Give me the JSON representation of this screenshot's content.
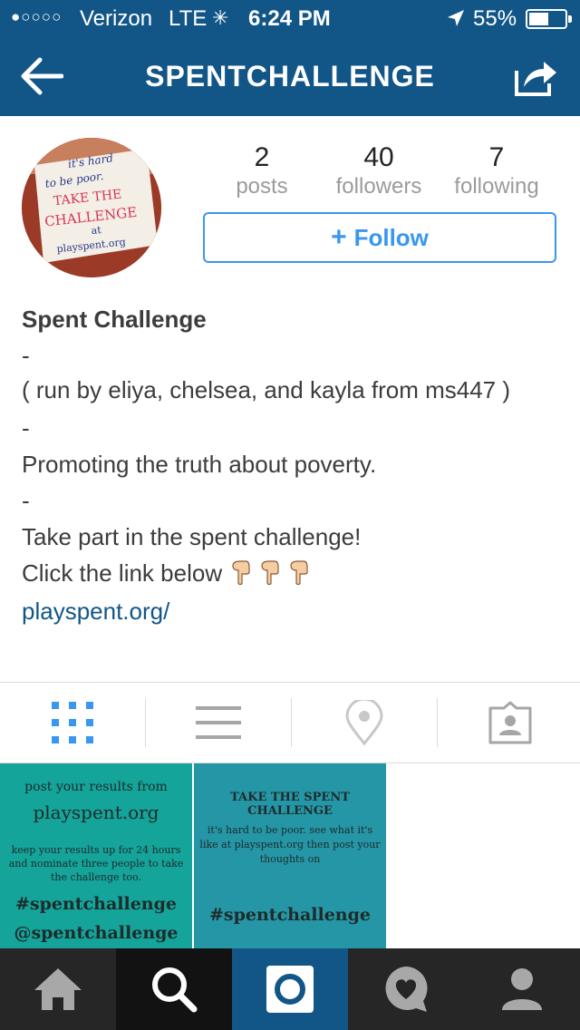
{
  "status_bar": {
    "signal_dots": "●○○○○",
    "carrier": "Verizon",
    "network": "LTE",
    "time": "6:24 PM",
    "battery_percent": "55%",
    "battery_level": 0.55
  },
  "header": {
    "title": "SPENTCHALLENGE"
  },
  "profile": {
    "stats": [
      {
        "value": "2",
        "label": "posts"
      },
      {
        "value": "40",
        "label": "followers"
      },
      {
        "value": "7",
        "label": "following"
      }
    ],
    "follow_label": "Follow",
    "avatar_text": {
      "line1": "it's hard",
      "line2": "to be poor.",
      "line3": "TAKE THE",
      "line4": "CHALLENGE",
      "line5": "at",
      "line6": "playspent.org"
    }
  },
  "bio": {
    "name": "Spent Challenge",
    "sep1": "-",
    "line1": "( run by eliya, chelsea, and kayla from ms447 )",
    "sep2": "-",
    "line2": "Promoting the truth about poverty.",
    "sep3": "-",
    "line3": "Take part in the spent challenge!",
    "line4": "Click the link below",
    "link": "playspent.org/"
  },
  "posts": [
    {
      "line1": "post your results from",
      "line2": "playspent.org",
      "line3": "keep your results up for 24 hours and nominate three people to take the challenge too.",
      "line4": "#spentchallenge",
      "line5": "@spentchallenge"
    },
    {
      "line1": "TAKE THE SPENT CHALLENGE",
      "line2": "it's hard to be poor. see what it's like at playspent.org then post your thoughts on",
      "line3": "#spentchallenge"
    }
  ],
  "colors": {
    "brand": "#125688",
    "follow_blue": "#3897f0",
    "post1_bg": "#14a49a",
    "post2_bg": "#2496a6",
    "nav_bg": "#262626"
  }
}
